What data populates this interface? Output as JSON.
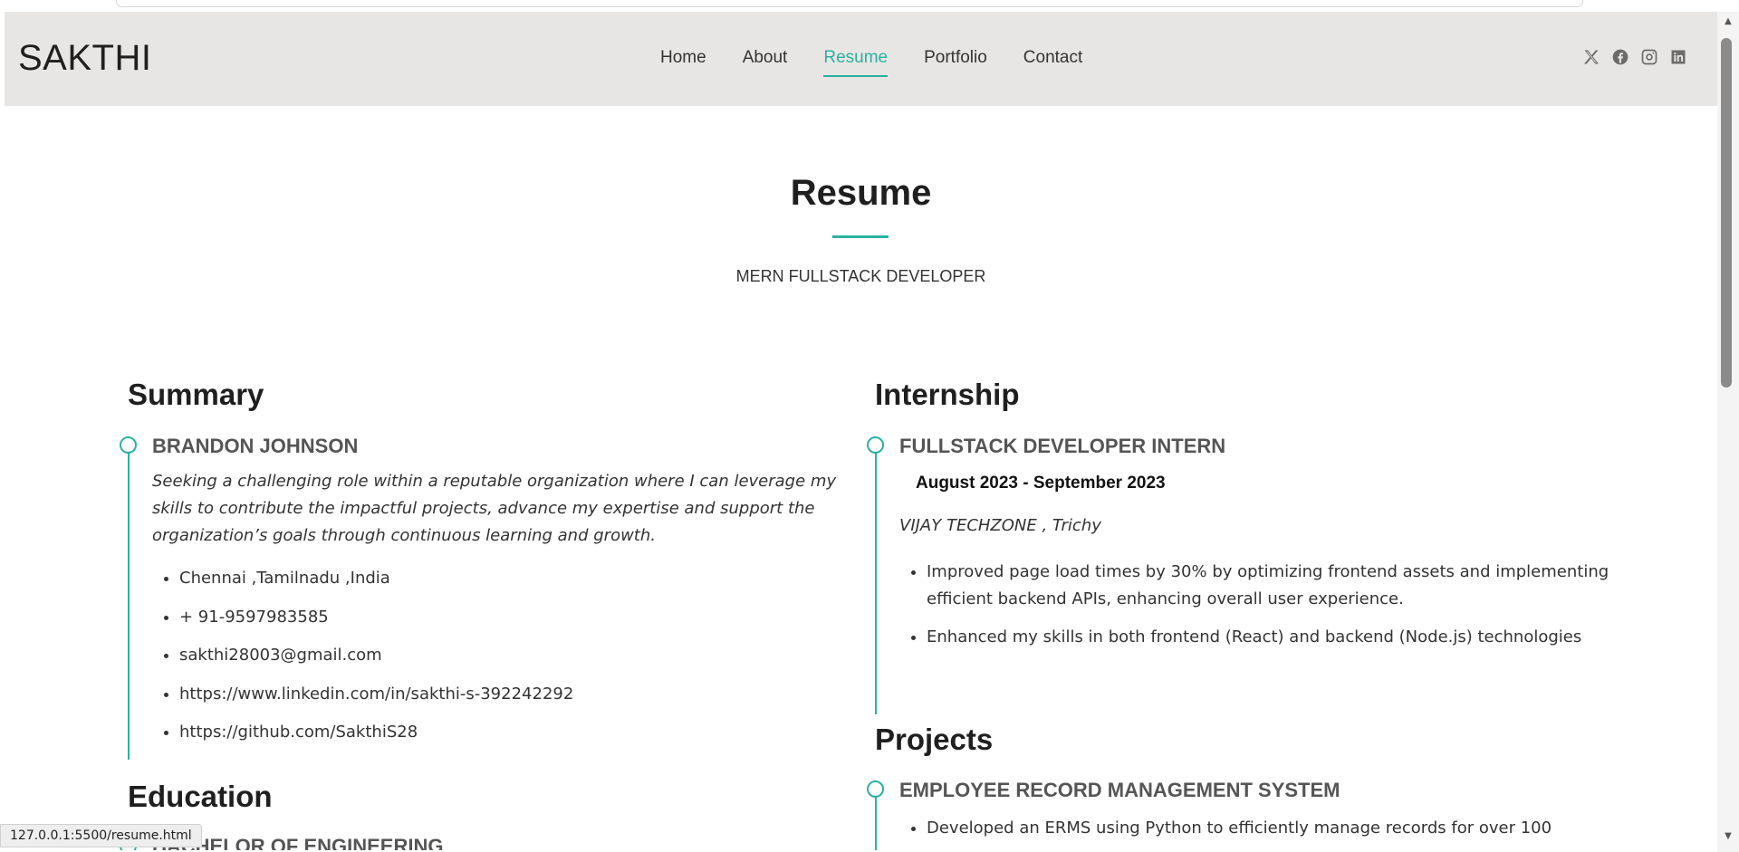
{
  "browser": {
    "status_url": "127.0.0.1:5500/resume.html"
  },
  "header": {
    "logo": "SAKTHI",
    "nav": [
      {
        "label": "Home"
      },
      {
        "label": "About"
      },
      {
        "label": "Resume",
        "active": true
      },
      {
        "label": "Portfolio"
      },
      {
        "label": "Contact"
      }
    ],
    "social_icons": [
      "x-twitter-icon",
      "facebook-icon",
      "instagram-icon",
      "linkedin-icon"
    ]
  },
  "page": {
    "title": "Resume",
    "subtitle": "MERN FULLSTACK DEVELOPER"
  },
  "summary": {
    "heading": "Summary",
    "name": "BRANDON JOHNSON",
    "description": "Seeking a challenging role within a reputable organization where I can leverage my skills to contribute the impactful projects, advance my expertise and support the organization’s goals through continuous learning and growth.",
    "contacts": [
      "Chennai ,Tamilnadu ,India",
      "+ 91-9597983585",
      "sakthi28003@gmail.com",
      "https://www.linkedin.com/in/sakthi-s-392242292",
      "https://github.com/SakthiS28"
    ]
  },
  "education": {
    "heading": "Education",
    "item_title": "BACHELOR OF ENGINEERING"
  },
  "internship": {
    "heading": "Internship",
    "role": "FULLSTACK DEVELOPER INTERN",
    "dates": "August 2023 - September 2023",
    "company": "VIJAY TECHZONE , Trichy",
    "points": [
      "Improved page load times by 30% by optimizing frontend assets and implementing efficient backend APIs, enhancing overall user experience.",
      "Enhanced my skills in both frontend (React) and backend (Node.js) technologies"
    ]
  },
  "projects": {
    "heading": "Projects",
    "item_title": "EMPLOYEE RECORD MANAGEMENT SYSTEM",
    "points": [
      "Developed an ERMS using Python to efficiently manage records for over 100"
    ]
  },
  "colors": {
    "accent": "#2bb0a1",
    "header_bg": "#e8e6e4"
  }
}
